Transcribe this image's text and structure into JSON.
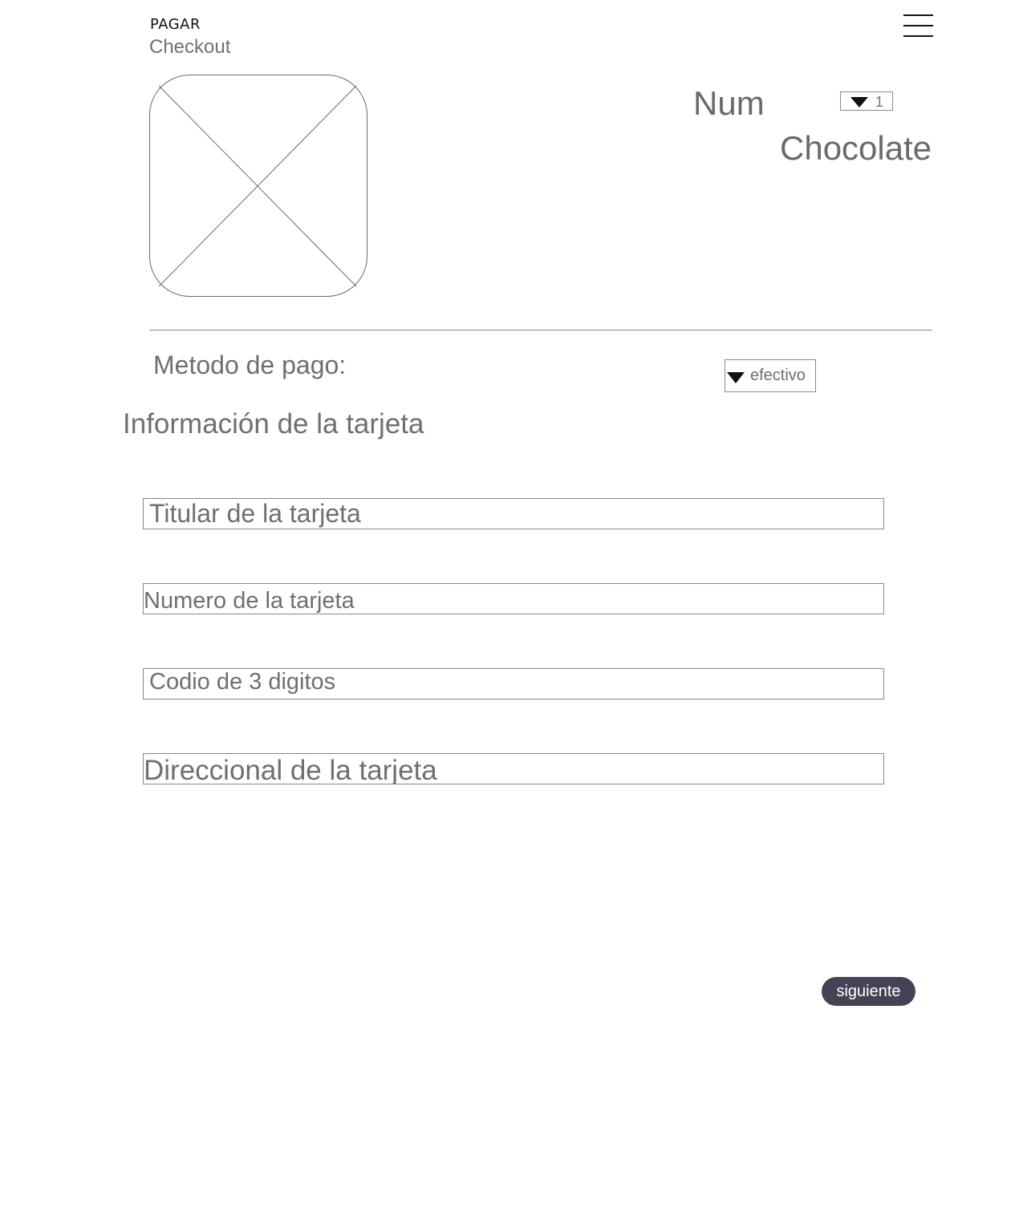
{
  "header": {
    "title": "PAGAR",
    "subtitle": "Checkout",
    "menu_icon": "hamburger-menu-icon"
  },
  "product": {
    "image_icon": "image-placeholder-icon",
    "quantity_label": "Num",
    "quantity_value": "1",
    "name": "Chocolate"
  },
  "payment": {
    "label": "Metodo de pago:",
    "selected_method": "efectivo"
  },
  "card_info": {
    "title": "Información de la tarjeta",
    "holder_placeholder": "Titular de la tarjeta",
    "number_placeholder": "Numero de la tarjeta",
    "cvv_placeholder": "Codio de 3 digitos",
    "address_placeholder": "Direccional de la tarjeta"
  },
  "actions": {
    "next_label": "siguiente",
    "next_color": "#434356"
  }
}
